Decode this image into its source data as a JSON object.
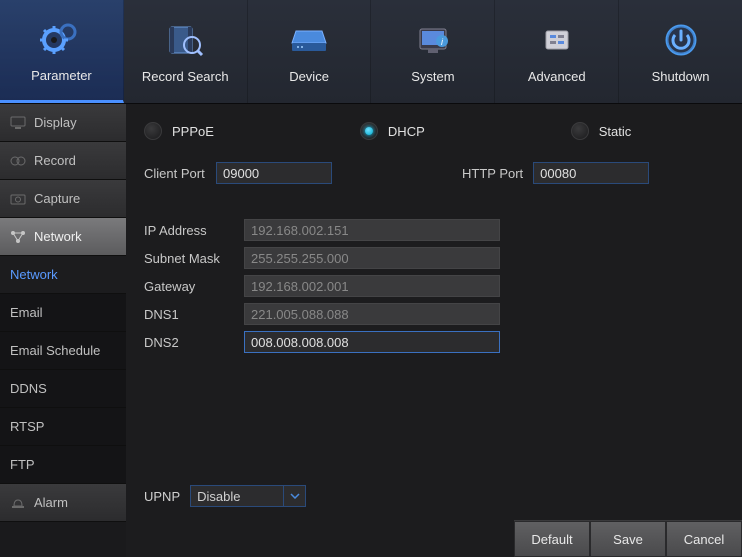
{
  "top_nav": [
    {
      "label": "Parameter",
      "icon": "gears-icon"
    },
    {
      "label": "Record Search",
      "icon": "film-search-icon"
    },
    {
      "label": "Device",
      "icon": "device-icon"
    },
    {
      "label": "System",
      "icon": "system-icon"
    },
    {
      "label": "Advanced",
      "icon": "advanced-icon"
    },
    {
      "label": "Shutdown",
      "icon": "power-icon"
    }
  ],
  "sidebar": {
    "categories": [
      {
        "label": "Display",
        "icon": "monitor-icon"
      },
      {
        "label": "Record",
        "icon": "record-icon"
      },
      {
        "label": "Capture",
        "icon": "capture-icon"
      },
      {
        "label": "Network",
        "icon": "network-icon"
      },
      {
        "label": "Alarm",
        "icon": "alarm-icon"
      }
    ],
    "subitems": [
      {
        "label": "Network"
      },
      {
        "label": "Email"
      },
      {
        "label": "Email Schedule"
      },
      {
        "label": "DDNS"
      },
      {
        "label": "RTSP"
      },
      {
        "label": "FTP"
      }
    ]
  },
  "network": {
    "mode_options": {
      "pppoe": "PPPoE",
      "dhcp": "DHCP",
      "static": "Static"
    },
    "selected_mode": "dhcp",
    "client_port_label": "Client Port",
    "client_port": "09000",
    "http_port_label": "HTTP Port",
    "http_port": "00080",
    "fields": {
      "ip_address": {
        "label": "IP Address",
        "value": "192.168.002.151",
        "disabled": true
      },
      "subnet_mask": {
        "label": "Subnet Mask",
        "value": "255.255.255.000",
        "disabled": true
      },
      "gateway": {
        "label": "Gateway",
        "value": "192.168.002.001",
        "disabled": true
      },
      "dns1": {
        "label": "DNS1",
        "value": "221.005.088.088",
        "disabled": true
      },
      "dns2": {
        "label": "DNS2",
        "value": "008.008.008.008",
        "disabled": false
      }
    },
    "upnp": {
      "label": "UPNP",
      "value": "Disable"
    }
  },
  "buttons": {
    "default": "Default",
    "save": "Save",
    "cancel": "Cancel"
  }
}
